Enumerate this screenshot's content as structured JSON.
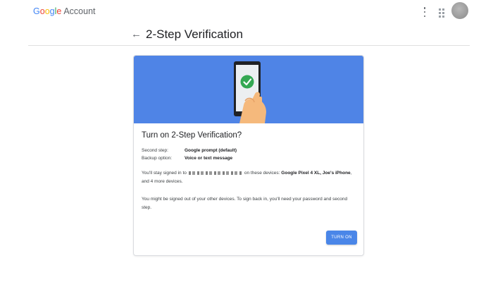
{
  "header": {
    "brand_letters": [
      "G",
      "o",
      "o",
      "g",
      "l",
      "e"
    ],
    "brand_suffix": "Account",
    "more_icon": "more-vert-icon",
    "apps_icon": "apps-grid-icon",
    "avatar": "account-avatar"
  },
  "page": {
    "back_icon": "arrow-back-icon",
    "title": "2-Step Verification"
  },
  "card": {
    "hero_color": "#4f84e6",
    "hero_icon": "phone-with-checkmark-icon",
    "title": "Turn on 2-Step Verification?",
    "second_step_label": "Second step:",
    "second_step_value": "Google prompt (default)",
    "backup_label": "Backup option:",
    "backup_value": "Voice or text message",
    "signed_in_prefix": "You'll stay signed in to",
    "signed_in_mid": "on these devices:",
    "device_1": "Google Pixel 4 XL",
    "device_sep": ",",
    "device_2": "Joe's iPhone",
    "signed_in_suffix": ", and 4 more devices.",
    "signout_note": "You might be signed out of your other devices. To sign back in, you'll need your password and second step.",
    "turn_on_button": "TURN ON",
    "accent_color": "#4a86e8"
  }
}
